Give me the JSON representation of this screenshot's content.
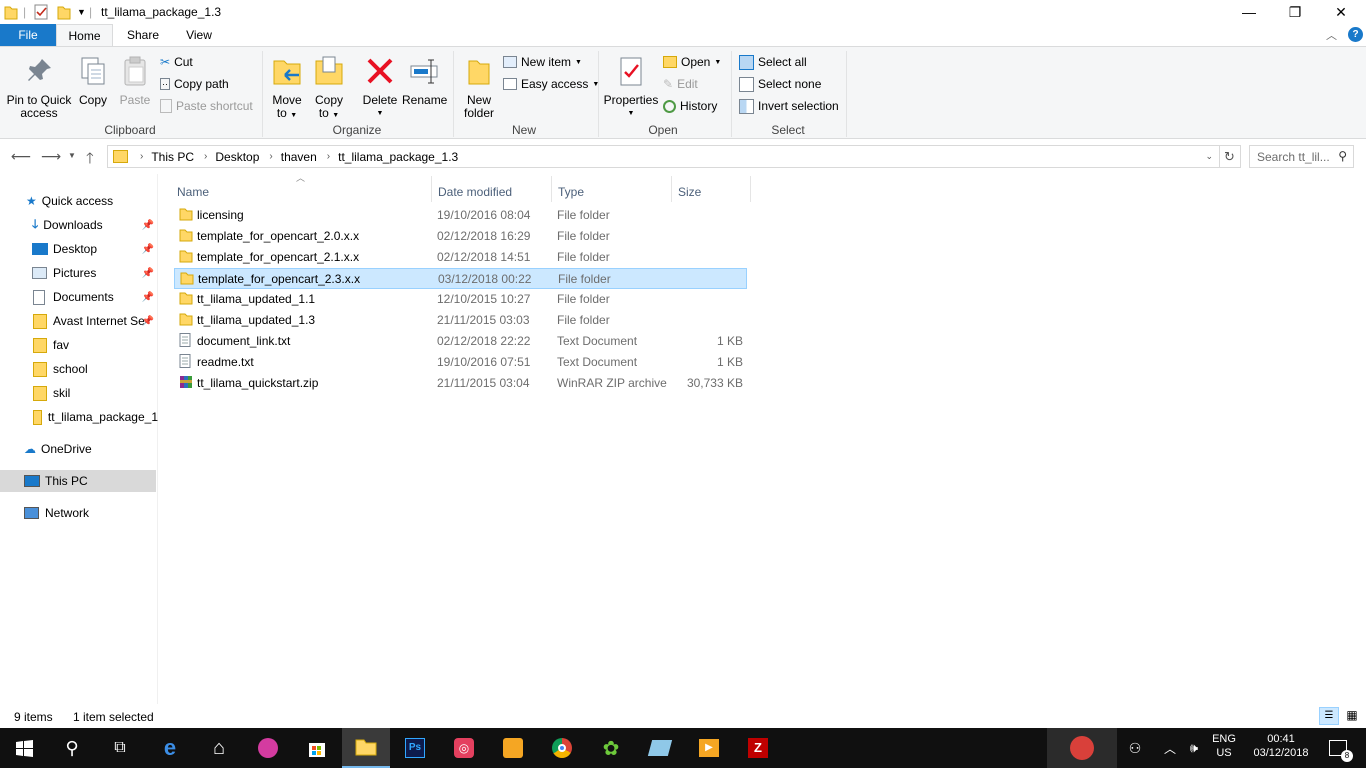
{
  "window": {
    "title": "tt_lilama_package_1.3",
    "minimize": "—",
    "maximize": "❐",
    "close": "✕"
  },
  "ribbon_tabs": [
    "File",
    "Home",
    "Share",
    "View"
  ],
  "ribbon": {
    "clipboard": {
      "pin": "Pin to Quick access",
      "pin_l1": "Pin to Quick",
      "pin_l2": "access",
      "copy": "Copy",
      "paste": "Paste",
      "cut": "Cut",
      "copy_path": "Copy path",
      "paste_shortcut": "Paste shortcut",
      "label": "Clipboard"
    },
    "organize": {
      "move_l1": "Move",
      "move_l2": "to",
      "copy_l1": "Copy",
      "copy_l2": "to",
      "delete": "Delete",
      "rename": "Rename",
      "label": "Organize"
    },
    "new": {
      "folder_l1": "New",
      "folder_l2": "folder",
      "new_item": "New item",
      "easy_access": "Easy access",
      "label": "New"
    },
    "open": {
      "properties": "Properties",
      "open": "Open",
      "edit": "Edit",
      "history": "History",
      "label": "Open"
    },
    "select": {
      "select_all": "Select all",
      "select_none": "Select none",
      "invert": "Invert selection",
      "label": "Select"
    }
  },
  "breadcrumb": [
    "This PC",
    "Desktop",
    "thaven",
    "tt_lilama_package_1.3"
  ],
  "search": {
    "placeholder": "Search tt_lil..."
  },
  "nav": {
    "quick_access": "Quick access",
    "items": [
      "Downloads",
      "Desktop",
      "Pictures",
      "Documents",
      "Avast Internet Se",
      "fav",
      "school",
      "skil",
      "tt_lilama_package_1"
    ],
    "onedrive": "OneDrive",
    "this_pc": "This PC",
    "network": "Network"
  },
  "columns": [
    "Name",
    "Date modified",
    "Type",
    "Size"
  ],
  "files": [
    {
      "name": "licensing",
      "date": "19/10/2016 08:04",
      "type": "File folder",
      "size": "",
      "icon": "folder-icon"
    },
    {
      "name": "template_for_opencart_2.0.x.x",
      "date": "02/12/2018 16:29",
      "type": "File folder",
      "size": "",
      "icon": "folder-icon"
    },
    {
      "name": "template_for_opencart_2.1.x.x",
      "date": "02/12/2018 14:51",
      "type": "File folder",
      "size": "",
      "icon": "folder-icon"
    },
    {
      "name": "template_for_opencart_2.3.x.x",
      "date": "03/12/2018 00:22",
      "type": "File folder",
      "size": "",
      "icon": "folder-icon",
      "selected": true
    },
    {
      "name": "tt_lilama_updated_1.1",
      "date": "12/10/2015 10:27",
      "type": "File folder",
      "size": "",
      "icon": "folder-icon"
    },
    {
      "name": "tt_lilama_updated_1.3",
      "date": "21/11/2015 03:03",
      "type": "File folder",
      "size": "",
      "icon": "folder-icon"
    },
    {
      "name": "document_link.txt",
      "date": "02/12/2018 22:22",
      "type": "Text Document",
      "size": "1 KB",
      "icon": "text-file-icon"
    },
    {
      "name": "readme.txt",
      "date": "19/10/2016 07:51",
      "type": "Text Document",
      "size": "1 KB",
      "icon": "text-file-icon"
    },
    {
      "name": "tt_lilama_quickstart.zip",
      "date": "21/11/2015 03:04",
      "type": "WinRAR ZIP archive",
      "size": "30,733 KB",
      "icon": "winrar-archive-icon"
    }
  ],
  "status": {
    "count": "9 items",
    "selected": "1 item selected"
  },
  "taskbar": {
    "lang": "ENG",
    "region": "US",
    "time": "00:41",
    "date": "03/12/2018",
    "notifications": "8"
  },
  "colors": {
    "accent": "#1979ca",
    "selection_bg": "#cce8ff",
    "selection_border": "#99d1ff",
    "folder": "#ffd766",
    "taskbar": "#101010"
  }
}
